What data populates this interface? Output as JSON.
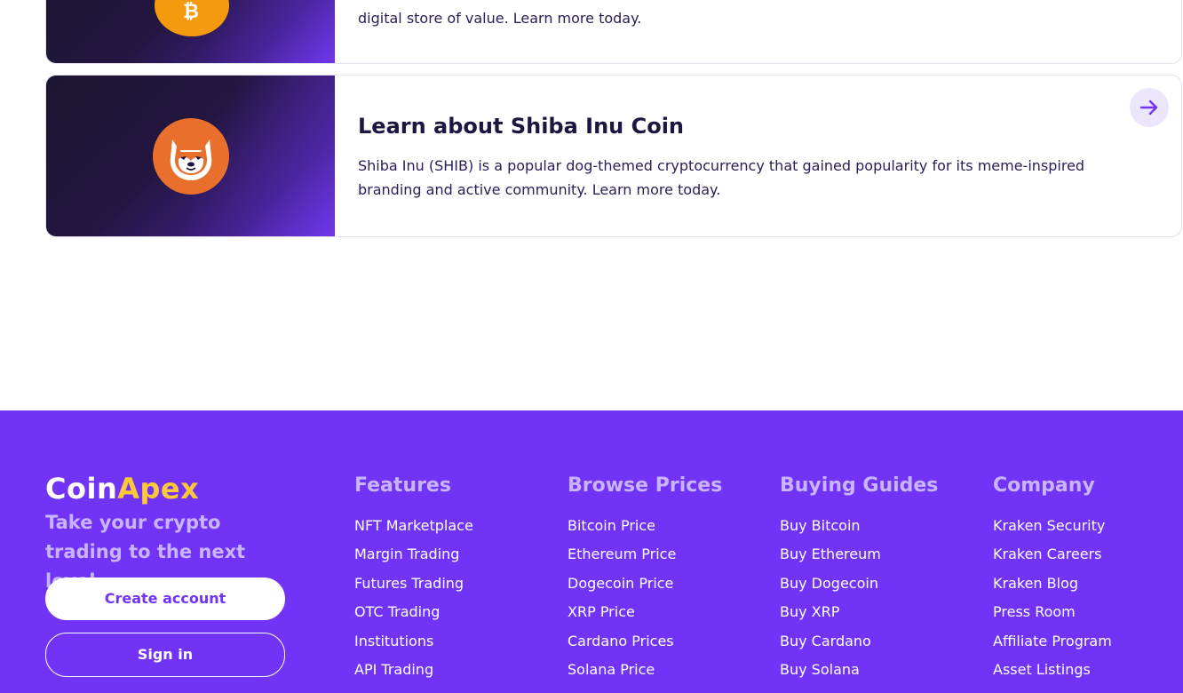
{
  "cards": [
    {
      "title": "",
      "description": "digital store of value. Learn more today.",
      "icon": "bitcoin-logo-icon"
    },
    {
      "title": "Learn about Shiba Inu Coin",
      "description": "Shiba Inu (SHIB) is a popular dog-themed cryptocurrency that gained popularity for its meme-inspired branding and active community. Learn more today.",
      "icon": "shiba-inu-logo-icon",
      "action_icon": "arrow-right-icon"
    }
  ],
  "footer": {
    "brand_main": "Coin",
    "brand_accent": "Apex",
    "tagline": "Take your crypto trading to the next level.",
    "create_account": "Create account",
    "sign_in": "Sign in",
    "columns": [
      {
        "heading": "Features",
        "links": [
          "NFT Marketplace",
          "Margin Trading",
          "Futures Trading",
          "OTC Trading",
          "Institutions",
          "API Trading"
        ]
      },
      {
        "heading": "Browse Prices",
        "links": [
          "Bitcoin Price",
          "Ethereum Price",
          "Dogecoin Price",
          "XRP Price",
          "Cardano Prices",
          "Solana Price"
        ]
      },
      {
        "heading": "Buying Guides",
        "links": [
          "Buy Bitcoin",
          "Buy Ethereum",
          "Buy Dogecoin",
          "Buy XRP",
          "Buy Cardano",
          "Buy Solana"
        ]
      },
      {
        "heading": "Company",
        "links": [
          "Kraken Security",
          "Kraken Careers",
          "Kraken Blog",
          "Press Room",
          "Affiliate Program",
          "Asset Listings"
        ]
      }
    ]
  },
  "colors": {
    "footer_bg": "#7133f5",
    "accent_yellow": "#fbc83a",
    "heading_lilac": "#c9b4ff",
    "title_dark": "#1e1540"
  }
}
